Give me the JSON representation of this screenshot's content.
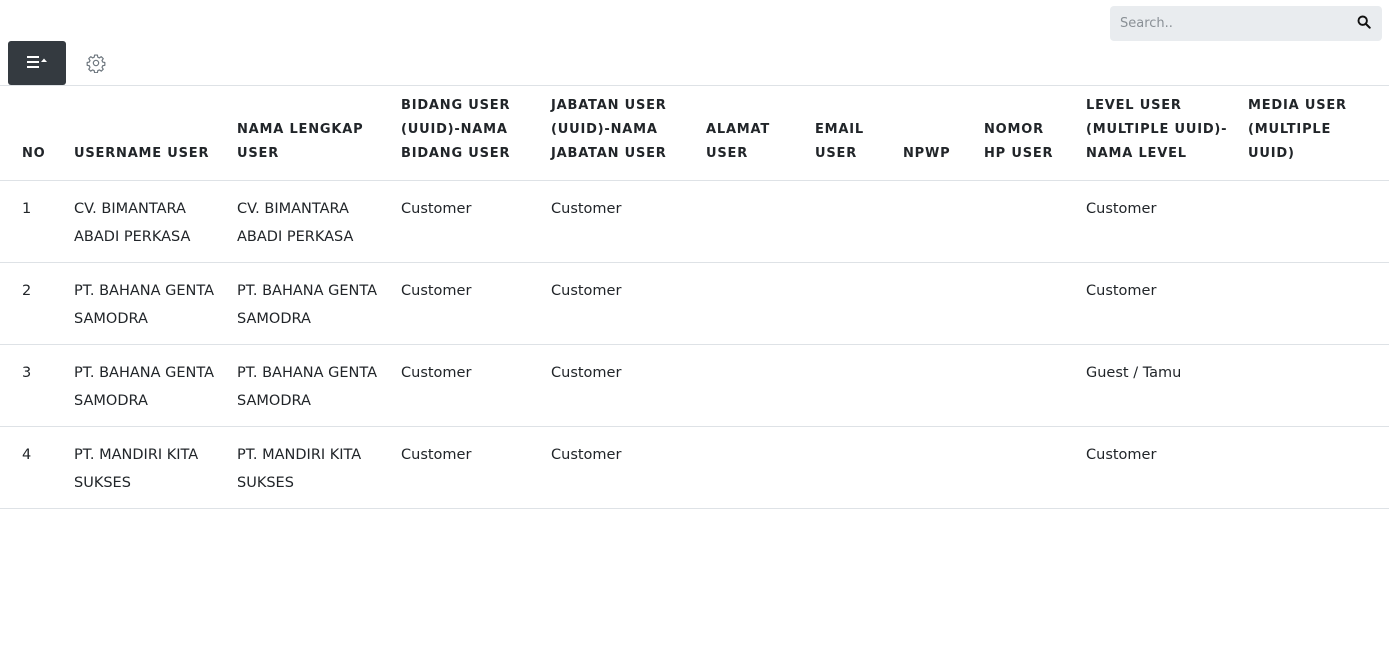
{
  "search": {
    "placeholder": "Search.."
  },
  "icons": {
    "search": "search-icon",
    "columns": "list-columns-icon",
    "settings": "gear-icon"
  },
  "colors": {
    "dark_button": "#343a40",
    "gear": "#6c757d",
    "search_bg": "#e9ecef",
    "border": "#dee2e6"
  },
  "table": {
    "headers": [
      "NO",
      "USERNAME USER",
      "NAMA LENGKAP USER",
      "BIDANG USER (UUID)-NAMA BIDANG USER",
      "JABATAN USER (UUID)-NAMA JABATAN USER",
      "ALAMAT USER",
      "EMAIL USER",
      "NPWP",
      "NOMOR HP USER",
      "LEVEL USER (MULTIPLE UUID)-NAMA LEVEL",
      "MEDIA USER (MULTIPLE UUID)"
    ],
    "rows": [
      [
        "1",
        "CV. BIMANTARA ABADI PERKASA",
        "CV. BIMANTARA ABADI PERKASA",
        "Customer",
        "Customer",
        "",
        "",
        "",
        "",
        "Customer",
        ""
      ],
      [
        "2",
        "PT. BAHANA GENTA SAMODRA",
        "PT. BAHANA GENTA SAMODRA",
        "Customer",
        "Customer",
        "",
        "",
        "",
        "",
        "Customer",
        ""
      ],
      [
        "3",
        "PT. BAHANA GENTA SAMODRA",
        "PT. BAHANA GENTA SAMODRA",
        "Customer",
        "Customer",
        "",
        "",
        "",
        "",
        "Guest / Tamu",
        ""
      ],
      [
        "4",
        "PT. MANDIRI KITA SUKSES",
        "PT. MANDIRI KITA SUKSES",
        "Customer",
        "Customer",
        "",
        "",
        "",
        "",
        "Customer",
        ""
      ]
    ]
  }
}
